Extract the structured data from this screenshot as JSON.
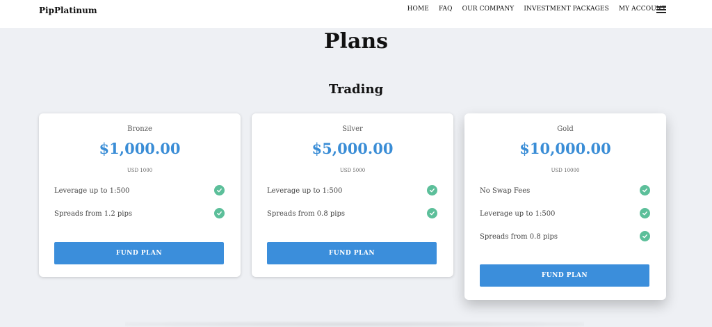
{
  "header": {
    "brand": "PipPlatinum",
    "nav": [
      "HOME",
      "FAQ",
      "OUR COMPANY",
      "INVESTMENT PACKAGES",
      "MY ACCOUNT"
    ],
    "menu_icon": "hamburger-menu-icon"
  },
  "page": {
    "title": "Plans",
    "section_title": "Trading"
  },
  "plans": [
    {
      "name": "Bronze",
      "price": "$1,000.00",
      "price_sub": "USD 1000",
      "features": [
        "Leverage up to 1:500",
        "Spreads from 1.2 pips"
      ],
      "button": "FUND PLAN"
    },
    {
      "name": "Silver",
      "price": "$5,000.00",
      "price_sub": "USD 5000",
      "features": [
        "Leverage up to 1:500",
        "Spreads from 0.8 pips"
      ],
      "button": "FUND PLAN"
    },
    {
      "name": "Gold",
      "price": "$10,000.00",
      "price_sub": "USD 10000",
      "features": [
        "No Swap Fees",
        "Leverage up to 1:500",
        "Spreads from 0.8 pips"
      ],
      "button": "FUND PLAN"
    }
  ],
  "colors": {
    "accent": "#3b8edb",
    "price": "#3a8dd6",
    "check": "#5cbf9a",
    "background": "#eef0f4"
  },
  "icons": {
    "feature_check": "check-circle-icon"
  }
}
